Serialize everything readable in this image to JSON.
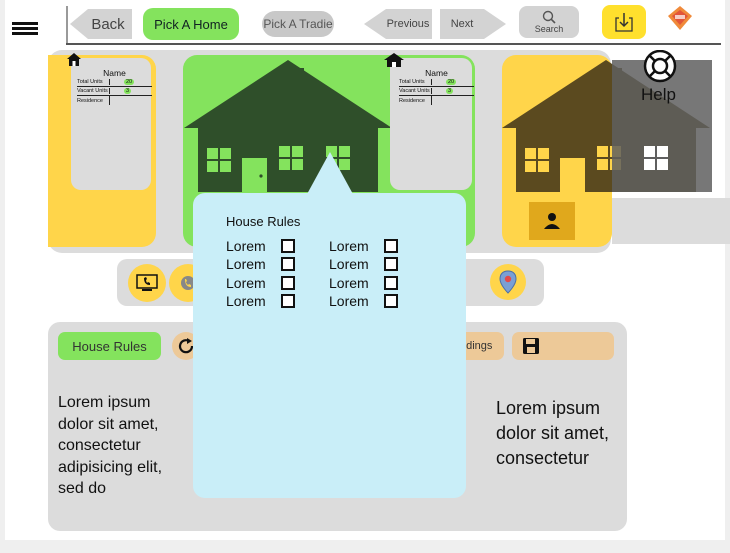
{
  "toolbar": {
    "back_label": "Back",
    "pick_home_label": "Pick A Home",
    "pick_tradie_label": "Pick A Tradie",
    "previous_label": "Previous",
    "next_label": "Next",
    "search_label": "Search",
    "help_label": "Help"
  },
  "cards": {
    "left": {
      "name_header": "Name",
      "rows": [
        {
          "label": "Total Units",
          "value": "20"
        },
        {
          "label": "Vacant Units",
          "value": "3"
        },
        {
          "label": "Residence",
          "value": ""
        }
      ]
    },
    "center": {
      "name_header": "Name",
      "rows": [
        {
          "label": "Total Units",
          "value": "20"
        },
        {
          "label": "Vacant Units",
          "value": "3"
        },
        {
          "label": "Residence",
          "value": ""
        }
      ]
    }
  },
  "bottom": {
    "house_rules_chip": "House Rules",
    "findings_chip": "ndings",
    "left_text": "Lorem ipsum dolor sit amet, consectetur adipisicing elit, sed do",
    "right_text": "Lorem ipsum dolor sit amet, consectetur"
  },
  "popover": {
    "title": "House Rules",
    "items": [
      "Lorem",
      "Lorem",
      "Lorem",
      "Lorem",
      "Lorem",
      "Lorem",
      "Lorem",
      "Lorem"
    ]
  },
  "colors": {
    "green": "#84e35d",
    "yellow": "#ffd54a",
    "grey": "#dcdcdc",
    "popover": "#c9eef8",
    "house_dark": "#2f4f2a"
  }
}
